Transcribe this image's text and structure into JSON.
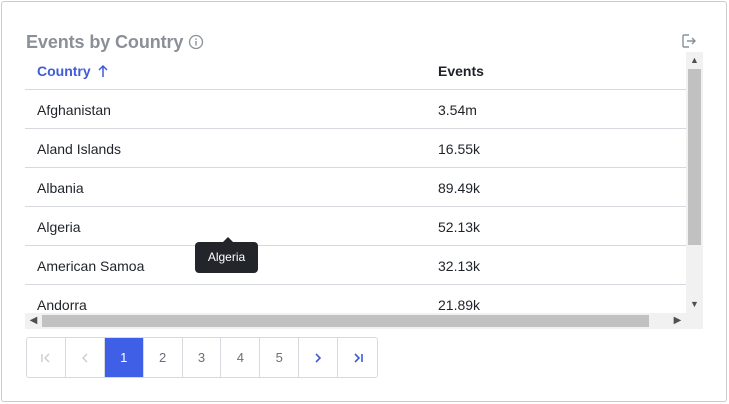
{
  "widget": {
    "title": "Events by Country"
  },
  "table": {
    "columns": {
      "country": "Country",
      "events": "Events"
    },
    "sort": {
      "column": "Country",
      "direction": "ascending"
    },
    "rows": [
      {
        "country": "Afghanistan",
        "events": "3.54m"
      },
      {
        "country": "Aland Islands",
        "events": "16.55k"
      },
      {
        "country": "Albania",
        "events": "89.49k"
      },
      {
        "country": "Algeria",
        "events": "52.13k"
      },
      {
        "country": "American Samoa",
        "events": "32.13k"
      },
      {
        "country": "Andorra",
        "events": "21.89k"
      }
    ]
  },
  "tooltip": {
    "text": "Algeria"
  },
  "pagination": {
    "pages": [
      "1",
      "2",
      "3",
      "4",
      "5"
    ],
    "current": "1"
  },
  "colors": {
    "accent": "#3f5fe6",
    "tooltip_bg": "#22262b",
    "title": "#8a8f98"
  },
  "icons": {
    "info": "info-circle-icon",
    "export": "export-icon",
    "sort": "arrow-up-icon"
  }
}
